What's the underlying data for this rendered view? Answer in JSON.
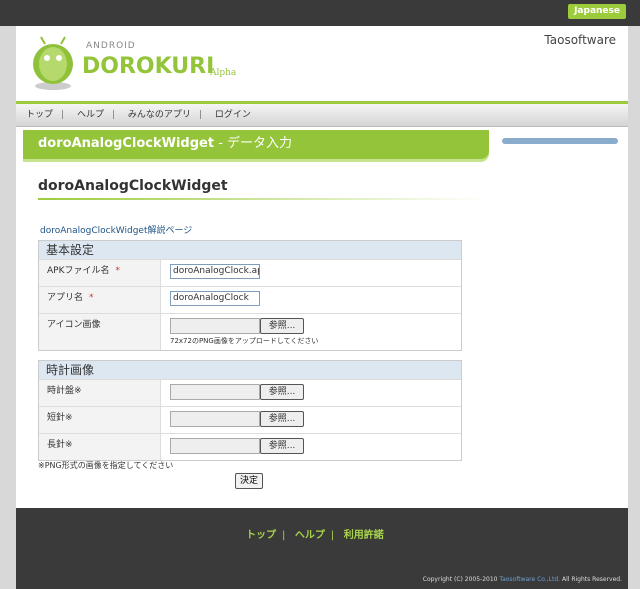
{
  "top": {
    "language_button": "Japanese"
  },
  "header": {
    "company": "Taosoftware",
    "android_word": "ANDROID",
    "brand": "DOROKURI",
    "alpha": "Alpha"
  },
  "nav": {
    "items": [
      "トップ",
      "ヘルプ",
      "みんなのアプリ",
      "ログイン"
    ],
    "separator": "|"
  },
  "title": {
    "app_name": "doroAnalogClockWidget",
    "dash": " - ",
    "section": "データ入力"
  },
  "heading": "doroAnalogClockWidget",
  "description_link": "doroAnalogClockWidget解説ページ",
  "basic": {
    "title": "基本設定",
    "apk_label": "APKファイル名",
    "apk_value": "doroAnalogClock.apk",
    "app_label": "アプリ名",
    "app_value": "doroAnalogClock",
    "icon_label": "アイコン画像",
    "icon_hint": "72x72のPNG画像をアップロードしてください",
    "required_mark": "*"
  },
  "clock": {
    "title": "時計画像",
    "dial_label": "時計盤※",
    "short_label": "短針※",
    "long_label": "長針※"
  },
  "browse_label": "参照...",
  "note": "※PNG形式の画像を指定してください",
  "submit_label": "決定",
  "footer": {
    "links": [
      "トップ",
      "ヘルプ",
      "利用許諾"
    ],
    "separator": "|",
    "copyright_prefix": "Copyright (C) 2005-2010 ",
    "copyright_company": "Taosoftware Co.,Ltd.",
    "copyright_suffix": " All Rights Reserved."
  },
  "colors": {
    "accent_green": "#94c43a",
    "dark_bar": "#3a3a3a",
    "section_blue": "#dde7f2"
  }
}
